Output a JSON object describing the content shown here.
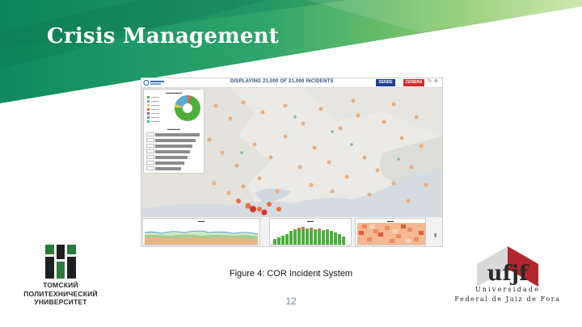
{
  "slide": {
    "title": "Crisis Management",
    "caption": "Figure 4: COR Incident System",
    "page_number": "12"
  },
  "dashboard": {
    "status_text": "DISPLAYING 21,000 OF 21,000 INCIDENTS",
    "button_blue": "SENDE",
    "button_red": "CENERA"
  },
  "logos": {
    "tpu_line1": "ТОМСКИЙ",
    "tpu_line2": "ПОЛИТЕХНИЧЕСКИЙ",
    "tpu_line3": "УНИВЕРСИТЕТ",
    "ufjf_mark": "ufjf",
    "ufjf_line1": "Universidade",
    "ufjf_line2": "Federal de Juiz de Fora"
  },
  "colors": {
    "banner_dark": "#0e8a5f",
    "banner_light": "#a8d86a",
    "pie_green": "#4caf3c",
    "pie_blue": "#5aa9d6",
    "cluster_orange": "#f0a06a",
    "cluster_red": "#d9322c",
    "ufjf_red": "#b3262b"
  }
}
